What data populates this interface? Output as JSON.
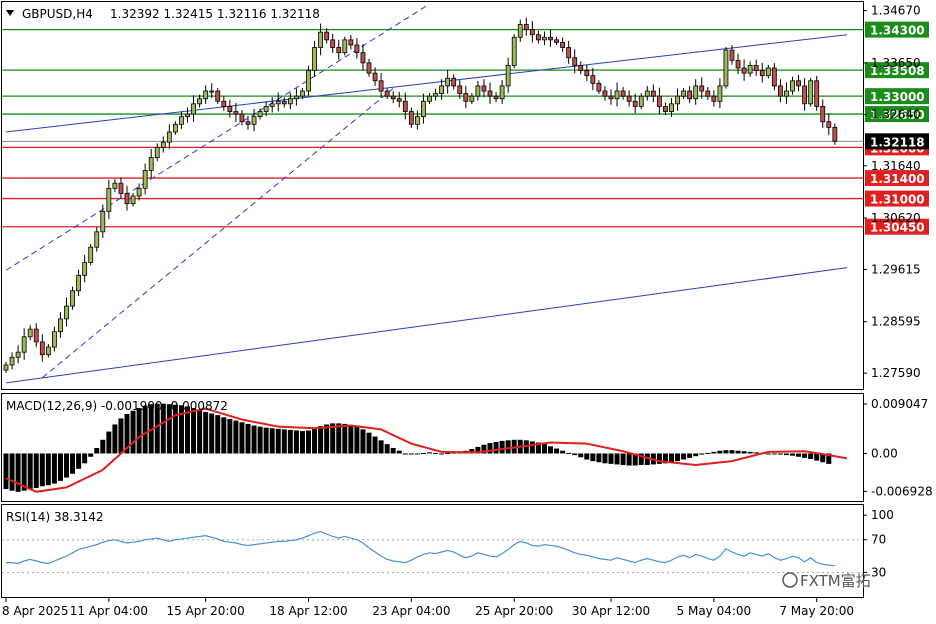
{
  "header": {
    "dropdown_icon": "triangle-down-icon",
    "symbol": "GBPUSD,H4",
    "ohlc": "1.32392 1.32415 1.32116 1.32118"
  },
  "watermark": {
    "icon": "fxtm-logo-icon",
    "text": "FXTM富拓"
  },
  "colors": {
    "bull_body": "#ffffff",
    "bear_body": "#c0504d",
    "candle_up_body": "#9bbb59",
    "wick": "#000000",
    "support": "#e02020",
    "resistance": "#1a8c1a",
    "trend": "#2a3fbf",
    "macd_line": "#e02020",
    "rsi_line": "#4a90d9",
    "badge_green": "#1a8c1a",
    "badge_red": "#e02020",
    "badge_current": "#000000"
  },
  "chart_data": [
    {
      "type": "candlestick",
      "title": "GBPUSD,H4",
      "price_axis_ticks": [
        "1.34670",
        "1.33650",
        "1.32640",
        "1.31640",
        "1.30620",
        "1.29615",
        "1.28595",
        "1.27590"
      ],
      "ylim": [
        1.273,
        1.348
      ],
      "x_tick_labels": [
        "8 Apr 2025",
        "11 Apr 04:00",
        "15 Apr 20:00",
        "18 Apr 12:00",
        "23 Apr 04:00",
        "25 Apr 20:00",
        "30 Apr 12:00",
        "5 May 04:00",
        "7 May 20:00"
      ],
      "current_price": "1.32118",
      "support_levels": [
        "1.32000",
        "1.31400",
        "1.31000",
        "1.30450"
      ],
      "resistance_levels": [
        "1.34300",
        "1.33508",
        "1.33000",
        "1.32650"
      ],
      "trendlines": [
        {
          "style": "solid",
          "points": [
            [
              0,
              1.323
            ],
            [
              139,
              1.342
            ]
          ]
        },
        {
          "style": "solid",
          "points": [
            [
              0,
              1.274
            ],
            [
              139,
              1.2965
            ]
          ]
        },
        {
          "style": "dashed",
          "points": [
            [
              0,
              1.296
            ],
            [
              70,
              1.348
            ]
          ]
        },
        {
          "style": "dashed",
          "points": [
            [
              6,
              1.275
            ],
            [
              64,
              1.3315
            ]
          ]
        }
      ],
      "closes": [
        1.2775,
        1.279,
        1.28,
        1.283,
        1.2845,
        1.282,
        1.2795,
        1.281,
        1.284,
        1.2865,
        1.289,
        1.292,
        1.295,
        1.2975,
        1.3005,
        1.3035,
        1.3075,
        1.312,
        1.313,
        1.311,
        1.309,
        1.3105,
        1.312,
        1.3155,
        1.318,
        1.32,
        1.321,
        1.323,
        1.3245,
        1.326,
        1.3265,
        1.3285,
        1.3295,
        1.331,
        1.331,
        1.329,
        1.328,
        1.327,
        1.3265,
        1.325,
        1.3245,
        1.326,
        1.327,
        1.328,
        1.3285,
        1.329,
        1.3285,
        1.3295,
        1.33,
        1.331,
        1.335,
        1.3395,
        1.3425,
        1.341,
        1.3395,
        1.3385,
        1.341,
        1.34,
        1.3385,
        1.3365,
        1.3345,
        1.333,
        1.331,
        1.33,
        1.3295,
        1.329,
        1.327,
        1.3245,
        1.326,
        1.329,
        1.33,
        1.3305,
        1.332,
        1.3335,
        1.332,
        1.3305,
        1.329,
        1.33,
        1.332,
        1.331,
        1.33,
        1.3295,
        1.332,
        1.336,
        1.3415,
        1.344,
        1.343,
        1.342,
        1.341,
        1.3415,
        1.341,
        1.3405,
        1.3395,
        1.3375,
        1.336,
        1.335,
        1.334,
        1.3325,
        1.331,
        1.33,
        1.3295,
        1.331,
        1.33,
        1.329,
        1.328,
        1.33,
        1.331,
        1.33,
        1.328,
        1.327,
        1.3285,
        1.33,
        1.331,
        1.3295,
        1.332,
        1.331,
        1.33,
        1.329,
        1.332,
        1.339,
        1.337,
        1.3355,
        1.3345,
        1.336,
        1.335,
        1.334,
        1.3355,
        1.332,
        1.33,
        1.331,
        1.333,
        1.332,
        1.3285,
        1.333,
        1.328,
        1.325,
        1.3239,
        1.3212
      ]
    },
    {
      "type": "histogram_line",
      "title": "MACD(12,26,9) -0.001900 -0.000872",
      "y_tick_labels": [
        "0.009047",
        "0.00",
        "-0.006928"
      ],
      "ylim": [
        -0.0085,
        0.0105
      ],
      "histogram": [
        -0.0065,
        -0.0068,
        -0.007,
        -0.0068,
        -0.0066,
        -0.0063,
        -0.006,
        -0.0058,
        -0.0055,
        -0.005,
        -0.0044,
        -0.0037,
        -0.0028,
        -0.0018,
        -0.0006,
        0.001,
        0.0025,
        0.004,
        0.0053,
        0.0064,
        0.0072,
        0.0078,
        0.0083,
        0.0087,
        0.009,
        0.0091,
        0.0091,
        0.009,
        0.0089,
        0.0088,
        0.0086,
        0.0083,
        0.0079,
        0.0076,
        0.0073,
        0.007,
        0.0066,
        0.0063,
        0.006,
        0.0057,
        0.0054,
        0.0051,
        0.0049,
        0.0047,
        0.0046,
        0.0045,
        0.0044,
        0.0043,
        0.0042,
        0.0041,
        0.0042,
        0.0045,
        0.005,
        0.0053,
        0.0055,
        0.0055,
        0.0054,
        0.0052,
        0.0049,
        0.0044,
        0.0038,
        0.0031,
        0.0024,
        0.0017,
        0.001,
        0.0005,
        0.0,
        -0.0001,
        0.0,
        0.0001,
        0.0002,
        0.0001,
        0.0,
        0.0001,
        0.0002,
        0.0003,
        0.0005,
        0.0008,
        0.0012,
        0.0016,
        0.0019,
        0.0021,
        0.0023,
        0.0024,
        0.0025,
        0.0025,
        0.0024,
        0.0022,
        0.002,
        0.0017,
        0.0013,
        0.0009,
        0.0005,
        0.0001,
        -0.0003,
        -0.0007,
        -0.0011,
        -0.0014,
        -0.0016,
        -0.0018,
        -0.0019,
        -0.002,
        -0.0021,
        -0.0022,
        -0.0022,
        -0.0021,
        -0.0021,
        -0.002,
        -0.0019,
        -0.0018,
        -0.0016,
        -0.0014,
        -0.0011,
        -0.0008,
        -0.0005,
        -0.0002,
        0.0001,
        0.0003,
        0.0005,
        0.0006,
        0.0006,
        0.0005,
        0.0004,
        0.0003,
        0.0002,
        0.0001,
        0.0,
        -0.0001,
        -0.0002,
        -0.0003,
        -0.0004,
        -0.0006,
        -0.0008,
        -0.001,
        -0.0013,
        -0.0016,
        -0.0019
      ],
      "signal_points": [
        [
          0,
          -0.0045
        ],
        [
          5,
          -0.007
        ],
        [
          10,
          -0.0062
        ],
        [
          16,
          -0.003
        ],
        [
          22,
          0.003
        ],
        [
          28,
          0.007
        ],
        [
          33,
          0.0082
        ],
        [
          39,
          0.0062
        ],
        [
          45,
          0.0049
        ],
        [
          51,
          0.0046
        ],
        [
          57,
          0.0051
        ],
        [
          62,
          0.0044
        ],
        [
          67,
          0.0018
        ],
        [
          72,
          0.0003
        ],
        [
          78,
          0.0002
        ],
        [
          84,
          0.0011
        ],
        [
          90,
          0.002
        ],
        [
          96,
          0.0018
        ],
        [
          102,
          0.0004
        ],
        [
          108,
          -0.0014
        ],
        [
          114,
          -0.0021
        ],
        [
          120,
          -0.0014
        ],
        [
          126,
          0.0003
        ],
        [
          132,
          0.0004
        ],
        [
          136,
          -0.0003
        ],
        [
          139,
          -0.0009
        ]
      ],
      "legend": [
        "MACD(12,26,9)",
        "-0.001900",
        "-0.000872"
      ]
    },
    {
      "type": "line",
      "title": "RSI(14) 38.3142",
      "y_tick_labels": [
        "100",
        "70",
        "30"
      ],
      "ylim": [
        0,
        110
      ],
      "levels": [
        70,
        30
      ],
      "values": [
        42,
        42,
        41,
        44,
        46,
        44,
        42,
        41,
        44,
        47,
        50,
        54,
        58,
        60,
        62,
        64,
        67,
        69,
        70,
        68,
        66,
        67,
        68,
        70,
        71,
        72,
        70,
        68,
        70,
        71,
        72,
        73,
        74,
        75,
        73,
        71,
        68,
        67,
        66,
        64,
        63,
        64,
        65,
        66,
        67,
        68,
        68,
        69,
        70,
        72,
        75,
        78,
        80,
        77,
        74,
        72,
        74,
        72,
        70,
        66,
        60,
        55,
        50,
        46,
        44,
        43,
        42,
        45,
        49,
        52,
        54,
        53,
        55,
        57,
        55,
        51,
        48,
        50,
        54,
        52,
        50,
        49,
        53,
        58,
        64,
        68,
        66,
        63,
        62,
        64,
        63,
        62,
        60,
        57,
        54,
        52,
        51,
        49,
        47,
        46,
        45,
        48,
        46,
        44,
        42,
        45,
        47,
        45,
        43,
        42,
        45,
        49,
        51,
        48,
        52,
        50,
        47,
        45,
        50,
        59,
        55,
        52,
        50,
        54,
        52,
        50,
        53,
        48,
        45,
        47,
        50,
        48,
        43,
        48,
        42,
        40,
        39,
        38.3
      ]
    }
  ]
}
